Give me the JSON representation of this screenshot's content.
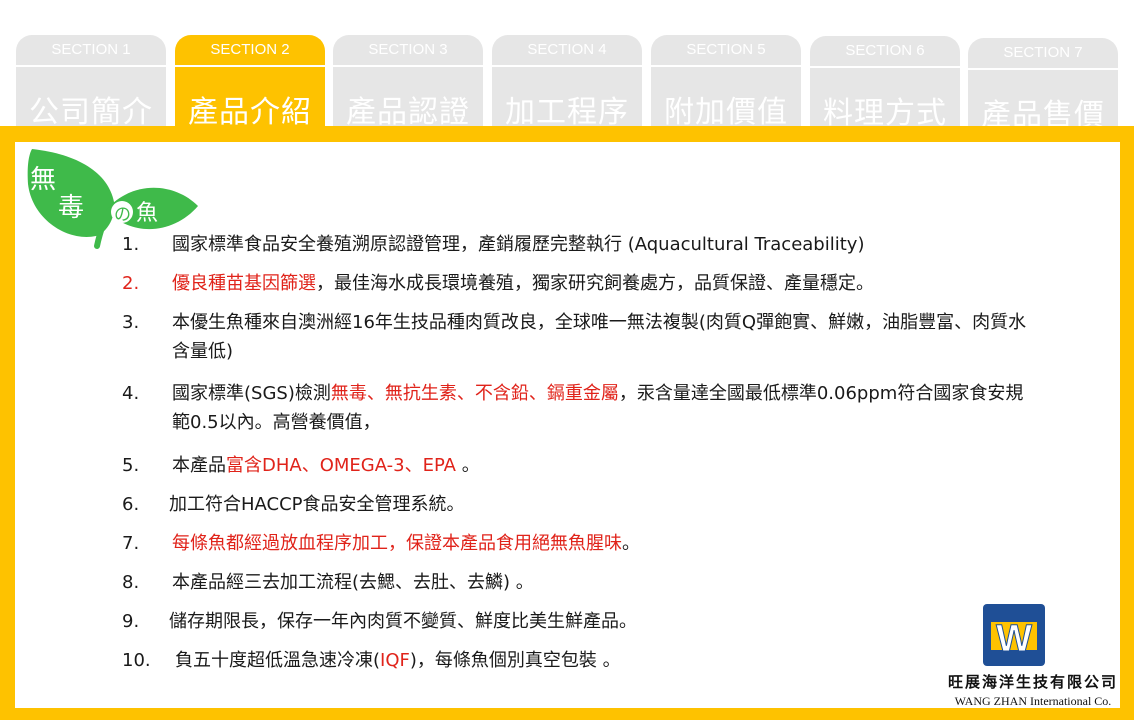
{
  "tabs": [
    {
      "section": "SECTION 1",
      "title": "公司簡介",
      "active": false
    },
    {
      "section": "SECTION 2",
      "title": "產品介紹",
      "active": true
    },
    {
      "section": "SECTION 3",
      "title": "產品認證",
      "active": false
    },
    {
      "section": "SECTION 4",
      "title": "加工程序",
      "active": false
    },
    {
      "section": "SECTION 5",
      "title": "附加價值",
      "active": false
    },
    {
      "section": "SECTION 6",
      "title": "料理方式",
      "active": false
    },
    {
      "section": "SECTION 7",
      "title": "產品售價",
      "active": false
    }
  ],
  "badge": {
    "line1": "無",
    "line2": "毒",
    "small": "の",
    "fish": "魚"
  },
  "items": [
    {
      "num": "1.",
      "parts": [
        {
          "t": "國家標準食品安全養殖溯原認證管理，產銷履歷完整執行 (Aquacultural Traceability)"
        }
      ]
    },
    {
      "num": "2.",
      "num_red": true,
      "parts": [
        {
          "t": "優良種苗基因篩選",
          "red": true
        },
        {
          "t": "，最佳海水成長環境養殖，獨家研究飼養處方，品質保證、產量穩定。"
        }
      ]
    },
    {
      "num": "3.",
      "parts": [
        {
          "t": "本優生魚種來自澳洲經16年生技品種肉質改良，全球唯一無法複製(肉質Q彈飽實、鮮嫩，油脂豐富、肉質水含量低)"
        }
      ]
    },
    {
      "num": "4.",
      "parts": [
        {
          "t": "國家標準(SGS)檢測"
        },
        {
          "t": "無毒、無抗生素、不含鉛、鎘重金屬",
          "red": true
        },
        {
          "t": "，汞含量達全國最低標準0.06ppm符合國家食安規範0.5以內。高營養價值，"
        }
      ]
    },
    {
      "num": "5.",
      "parts": [
        {
          "t": "本產品"
        },
        {
          "t": "富含DHA、OMEGA-3、EPA",
          "red": true
        },
        {
          "t": " 。"
        }
      ]
    },
    {
      "num": "6.",
      "parts": [
        {
          "t": "加工符合HACCP食品安全管理系統。"
        }
      ]
    },
    {
      "num": "7.",
      "parts": [
        {
          "t": "每條魚都經過放血程序加工，保證本產品食用絕無魚腥味",
          "red": true
        },
        {
          "t": "。"
        }
      ]
    },
    {
      "num": "8.",
      "parts": [
        {
          "t": "本產品經三去加工流程(去鰓、去肚、去鱗) 。"
        }
      ]
    },
    {
      "num": "9.",
      "parts": [
        {
          "t": "儲存期限長，保存一年內肉質不變質、鮮度比美生鮮產品。"
        }
      ]
    },
    {
      "num": "10.",
      "parts": [
        {
          "t": "負五十度超低溫急速冷凍("
        },
        {
          "t": "IQF",
          "red": true
        },
        {
          "t": ")，每條魚個別真空包裝 。"
        }
      ]
    }
  ],
  "company": {
    "logo_letter": "W",
    "name_cn": "旺展海洋生技有限公司",
    "name_en": "WANG ZHAN International Co."
  },
  "colors": {
    "accent": "#fec200",
    "tab_inactive": "#e6e6e6",
    "highlight_red": "#e0231a",
    "leaf_green": "#3fba4a",
    "logo_blue": "#1f4f96"
  }
}
